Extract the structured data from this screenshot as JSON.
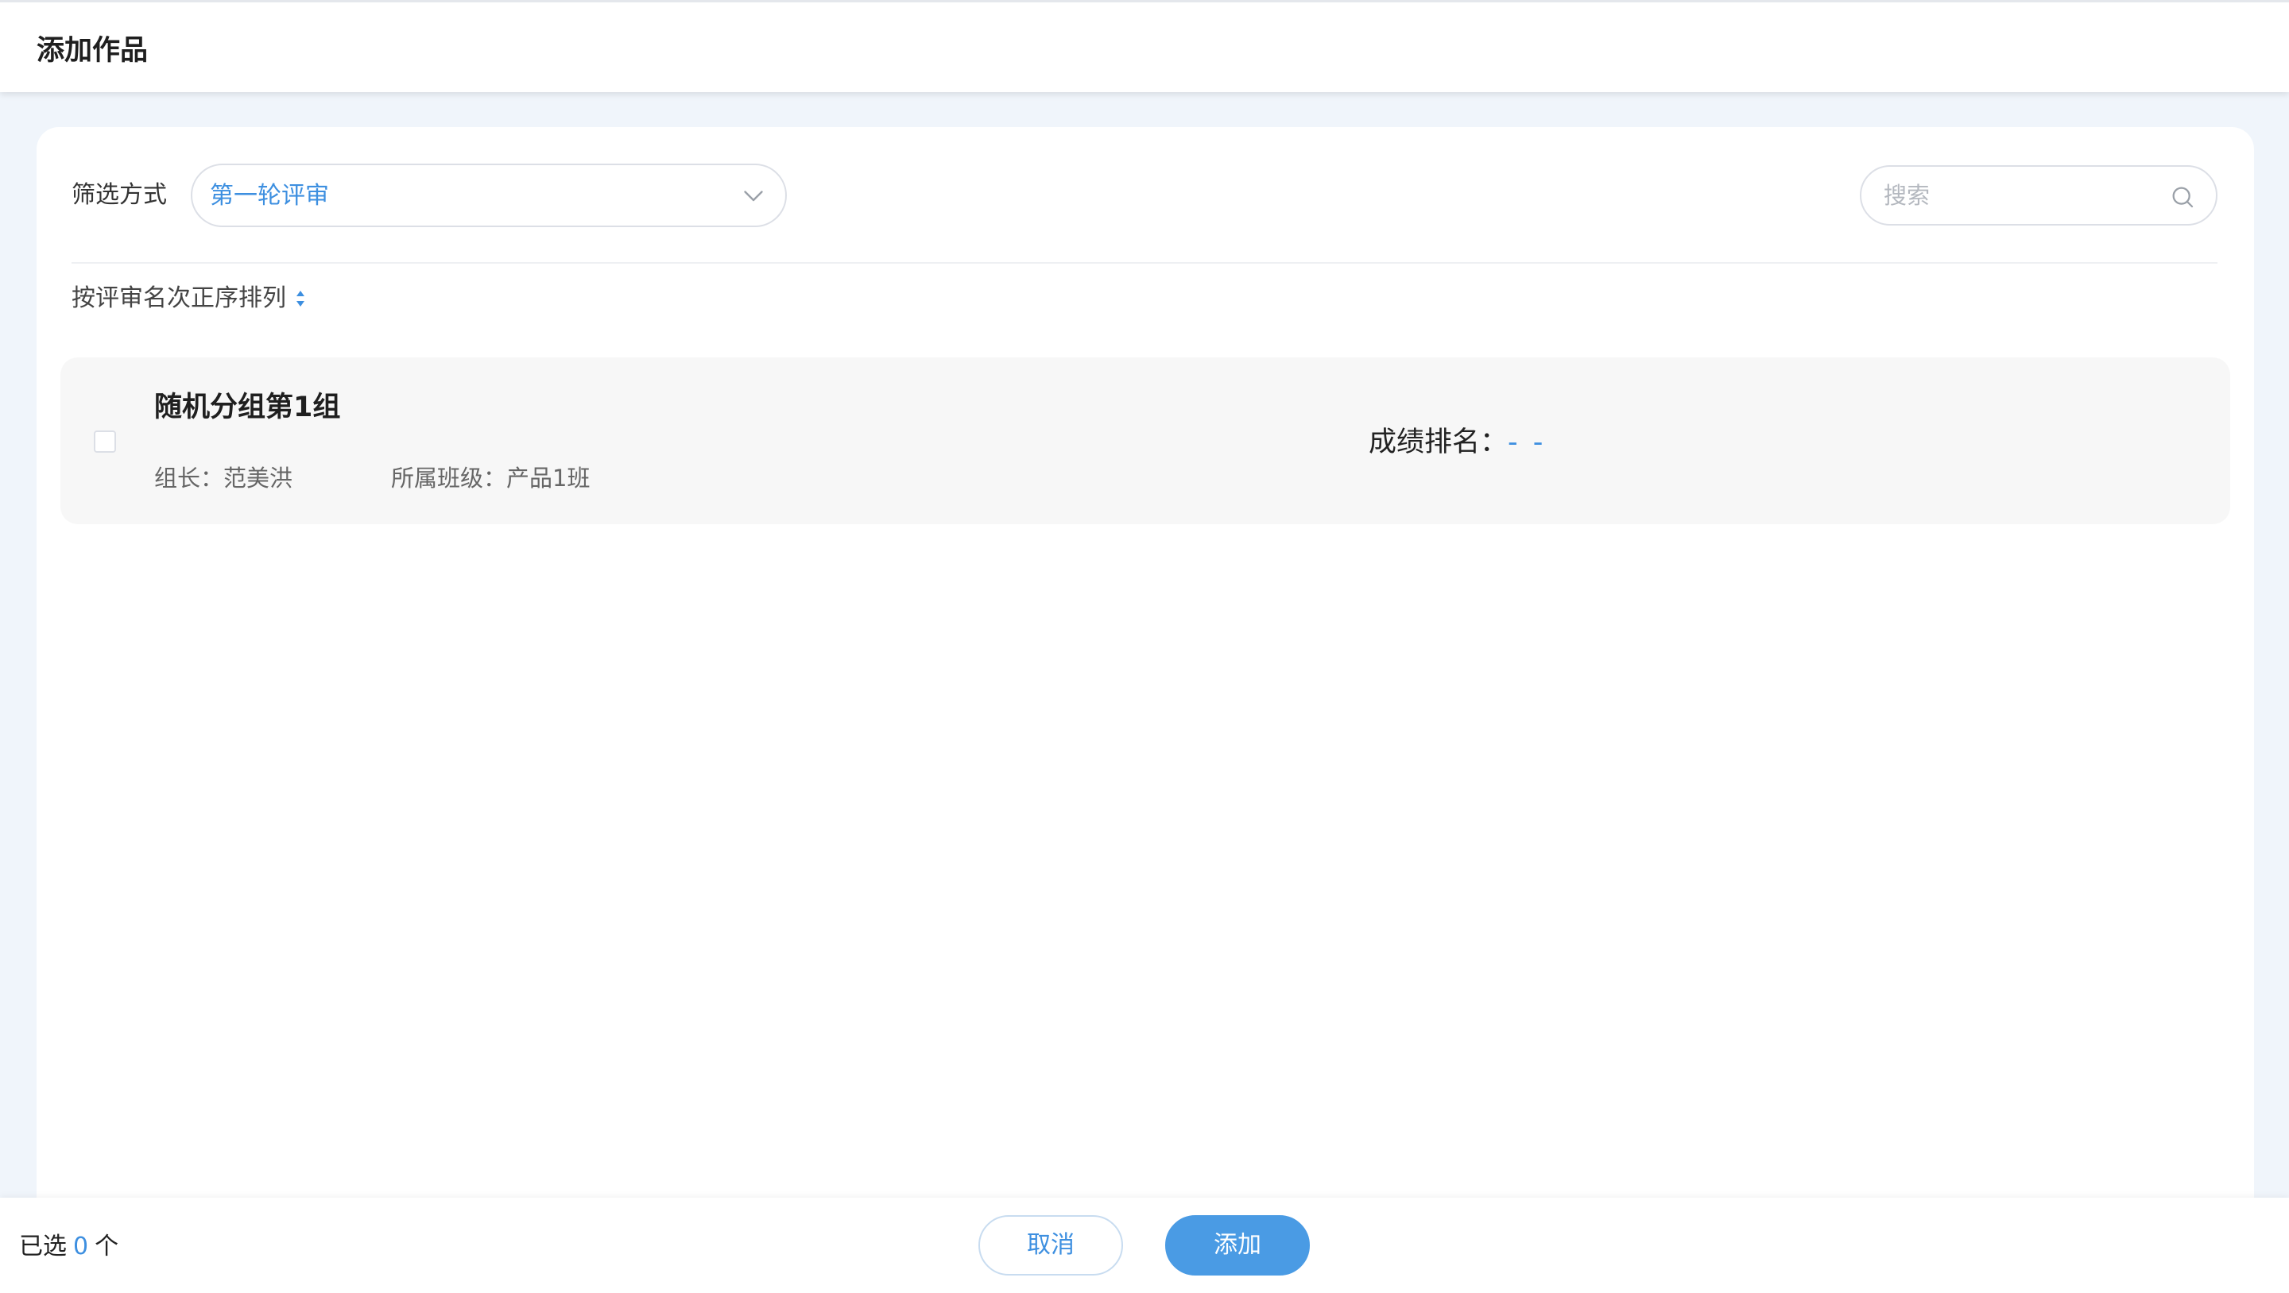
{
  "header": {
    "title": "添加作品"
  },
  "filter": {
    "label": "筛选方式",
    "selected": "第一轮评审"
  },
  "search": {
    "placeholder": "搜索"
  },
  "sort": {
    "label": "按评审名次正序排列"
  },
  "items": [
    {
      "title": "随机分组第1组",
      "leader": "组长：范美洪",
      "class": "所属班级：产品1班",
      "rank_label": "成绩排名：",
      "rank_value": "- -"
    }
  ],
  "footer": {
    "selected_prefix": "已选",
    "selected_count": "0",
    "selected_suffix": "个",
    "cancel_label": "取消",
    "add_label": "添加"
  },
  "colors": {
    "accent": "#3d8fe0",
    "primary_button": "#4a9be4",
    "background": "#f0f5fb"
  },
  "icons": {
    "select": "chevron-down-icon",
    "search": "search-icon",
    "sort": "sort-icon"
  }
}
